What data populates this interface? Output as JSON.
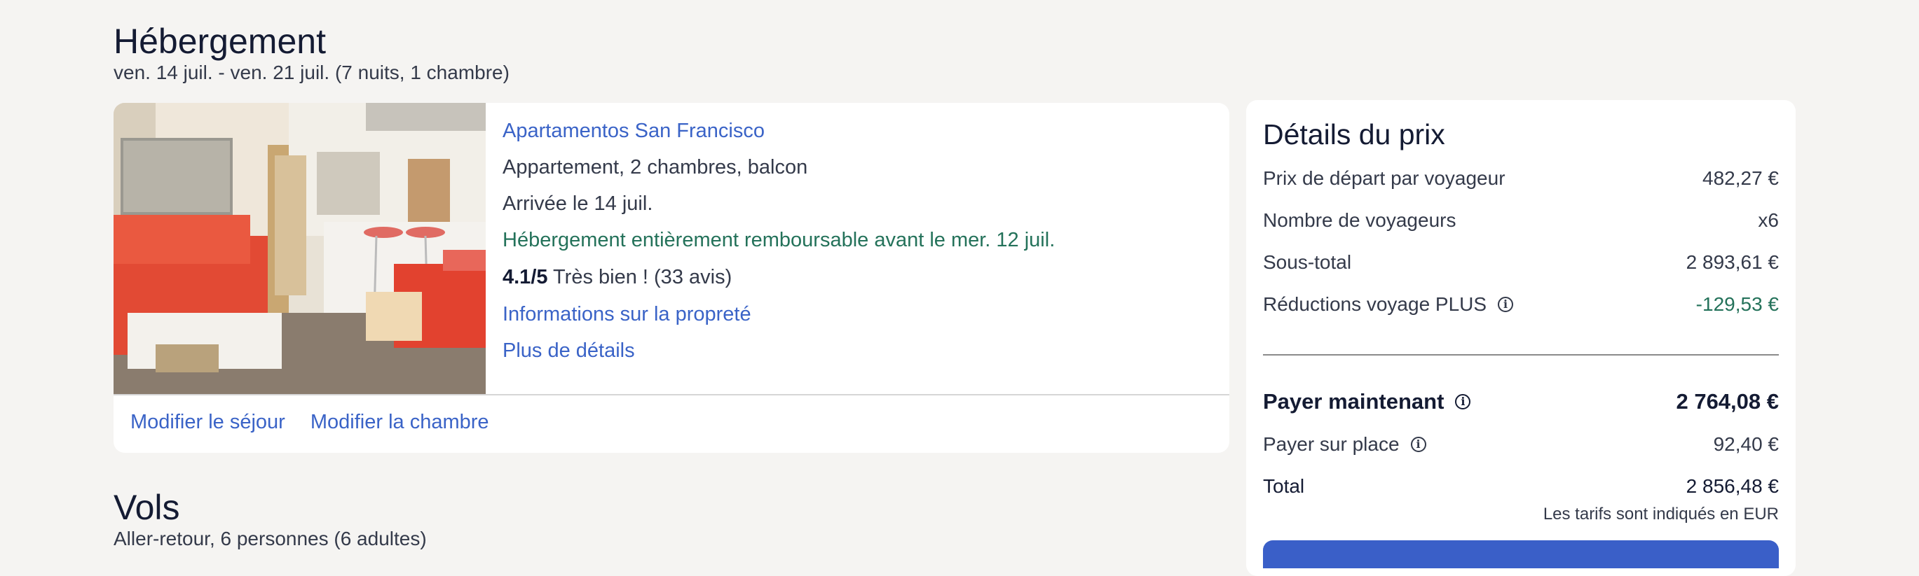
{
  "accommodation": {
    "heading": "Hébergement",
    "dates": "ven. 14 juil. - ven. 21 juil. (7 nuits, 1 chambre)",
    "hotel_name": "Apartamentos San Francisco",
    "room_type": "Appartement, 2 chambres, balcon",
    "checkin": "Arrivée le 14 juil.",
    "refund_policy": "Hébergement entièrement remboursable avant le mer. 12 juil.",
    "rating_score": "4.1/5",
    "rating_text": "Très bien ! (33 avis)",
    "cleanliness_link": "Informations sur la propreté",
    "more_details_link": "Plus de détails",
    "modify_stay": "Modifier le séjour",
    "modify_room": "Modifier la chambre"
  },
  "flights": {
    "heading": "Vols",
    "summary": "Aller-retour, 6 personnes (6 adultes)"
  },
  "price_details": {
    "title": "Détails du prix",
    "rows": [
      {
        "label": "Prix de départ par voyageur",
        "value": "482,27 €"
      },
      {
        "label": "Nombre de voyageurs",
        "value": "x6"
      },
      {
        "label": "Sous-total",
        "value": "2 893,61 €"
      },
      {
        "label": "Réductions voyage PLUS",
        "value": "-129,53 €"
      }
    ],
    "pay_now_label": "Payer maintenant",
    "pay_now_value": "2 764,08 €",
    "pay_on_site_label": "Payer sur place",
    "pay_on_site_value": "92,40 €",
    "total_label": "Total",
    "total_value": "2 856,48 €",
    "currency_note": "Les tarifs sont indiqués en EUR"
  },
  "colors": {
    "link": "#3a63c7",
    "discount": "#24725a",
    "cta": "#3a5fc8"
  },
  "icons": [
    "info-icon"
  ]
}
